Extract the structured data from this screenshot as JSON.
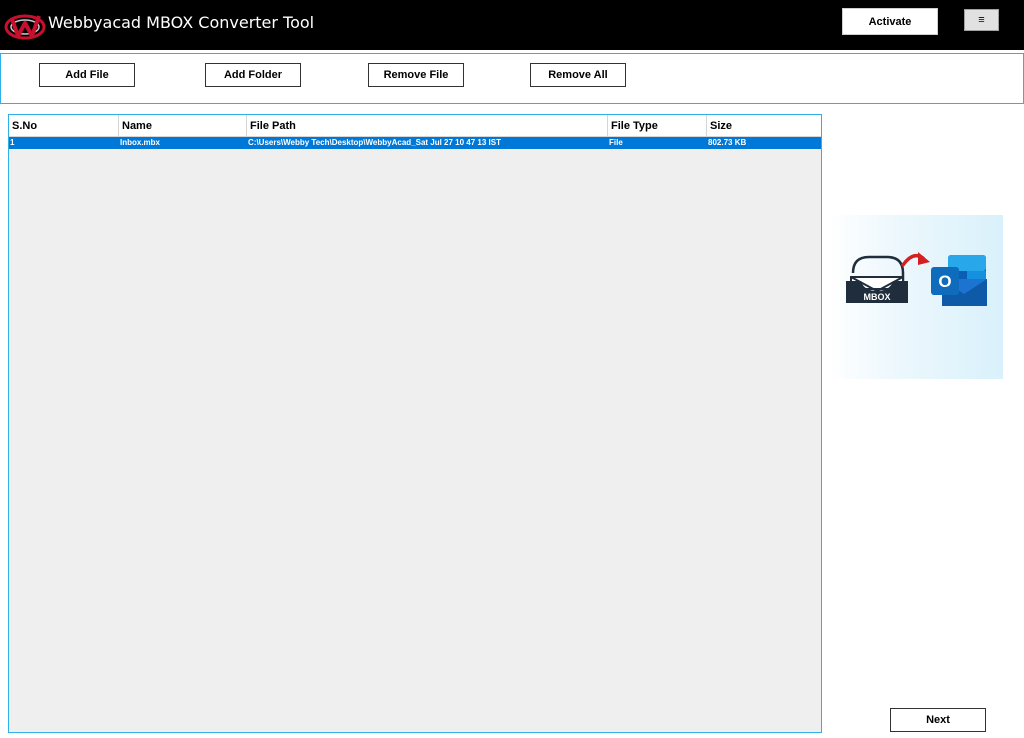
{
  "app": {
    "title": "Webbyacad MBOX Converter Tool"
  },
  "header": {
    "activate_label": "Activate",
    "menu_label": "≡"
  },
  "toolbar": {
    "add_file": "Add File",
    "add_folder": "Add Folder",
    "remove_file": "Remove File",
    "remove_all": "Remove All"
  },
  "grid": {
    "columns": [
      "S.No",
      "Name",
      "File Path",
      "File Type",
      "Size"
    ],
    "rows": [
      {
        "sno": "1",
        "name": "Inbox.mbx",
        "path": "C:\\Users\\Webby Tech\\Desktop\\WebbyAcad_Sat Jul 27 10 47 13 IST",
        "type": "File",
        "size": "802.73 KB",
        "selected": true
      }
    ]
  },
  "banner": {
    "mbox_label": "MBOX",
    "outlook_letter": "O",
    "icons": [
      "mbox-tray-icon",
      "arrow-icon",
      "outlook-icon"
    ]
  },
  "footer": {
    "next_label": "Next"
  },
  "colors": {
    "accent_border": "#2fb0e6",
    "selection": "#0078d7",
    "titlebar": "#000000",
    "arrow": "#d42020",
    "logo_red": "#c8102e"
  }
}
